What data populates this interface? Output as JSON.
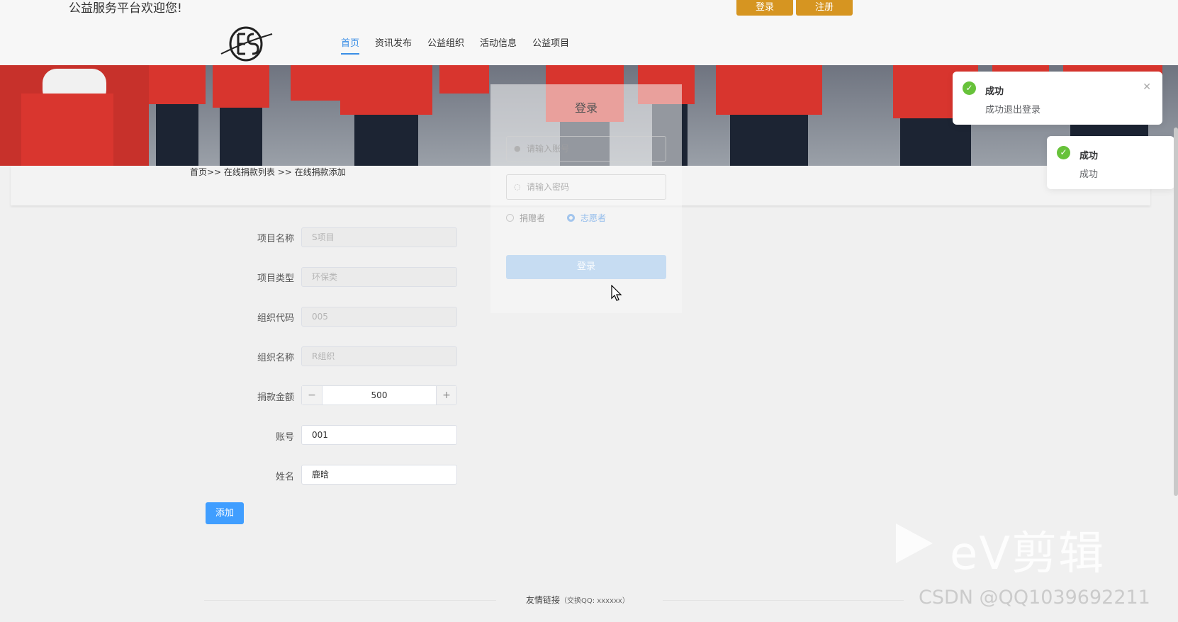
{
  "header": {
    "welcome": "公益服务平台欢迎您!",
    "login_button": "登录",
    "register_button": "注册",
    "accent_color": "#d69521"
  },
  "nav": {
    "items": [
      {
        "label": "首页",
        "active": true
      },
      {
        "label": "资讯发布"
      },
      {
        "label": "公益组织"
      },
      {
        "label": "活动信息"
      },
      {
        "label": "公益项目"
      }
    ]
  },
  "breadcrumb": "首页>> 在线捐款列表 >> 在线捐款添加",
  "form": {
    "project_name_label": "项目名称",
    "project_name_value": "S项目",
    "project_type_label": "项目类型",
    "project_type_value": "环保类",
    "org_code_label": "组织代码",
    "org_code_value": "005",
    "org_name_label": "组织名称",
    "org_name_value": "R组织",
    "amount_label": "捐款金额",
    "amount_value": "500",
    "amount_minus": "−",
    "amount_plus": "+",
    "account_label": "账号",
    "account_value": "001",
    "name_label": "姓名",
    "name_value": "鹿晗",
    "add_button": "添加",
    "primary_color": "#409eff"
  },
  "login_dialog": {
    "title": "登录",
    "account_placeholder": "请输入账号",
    "password_placeholder": "请输入密码",
    "role_donor": "捐赠者",
    "role_volunteer": "志愿者",
    "submit": "登录"
  },
  "notifications": [
    {
      "title": "成功",
      "message": "成功退出登录",
      "icon": "check-circle-icon"
    },
    {
      "title": "成功",
      "message": "成功",
      "icon": "check-circle-icon"
    }
  ],
  "footer": {
    "links_label": "友情链接",
    "qq_note": "（交换QQ: xxxxxx）"
  },
  "watermarks": {
    "editor": "eV剪辑",
    "csdn": "CSDN @QQ1039692211"
  }
}
